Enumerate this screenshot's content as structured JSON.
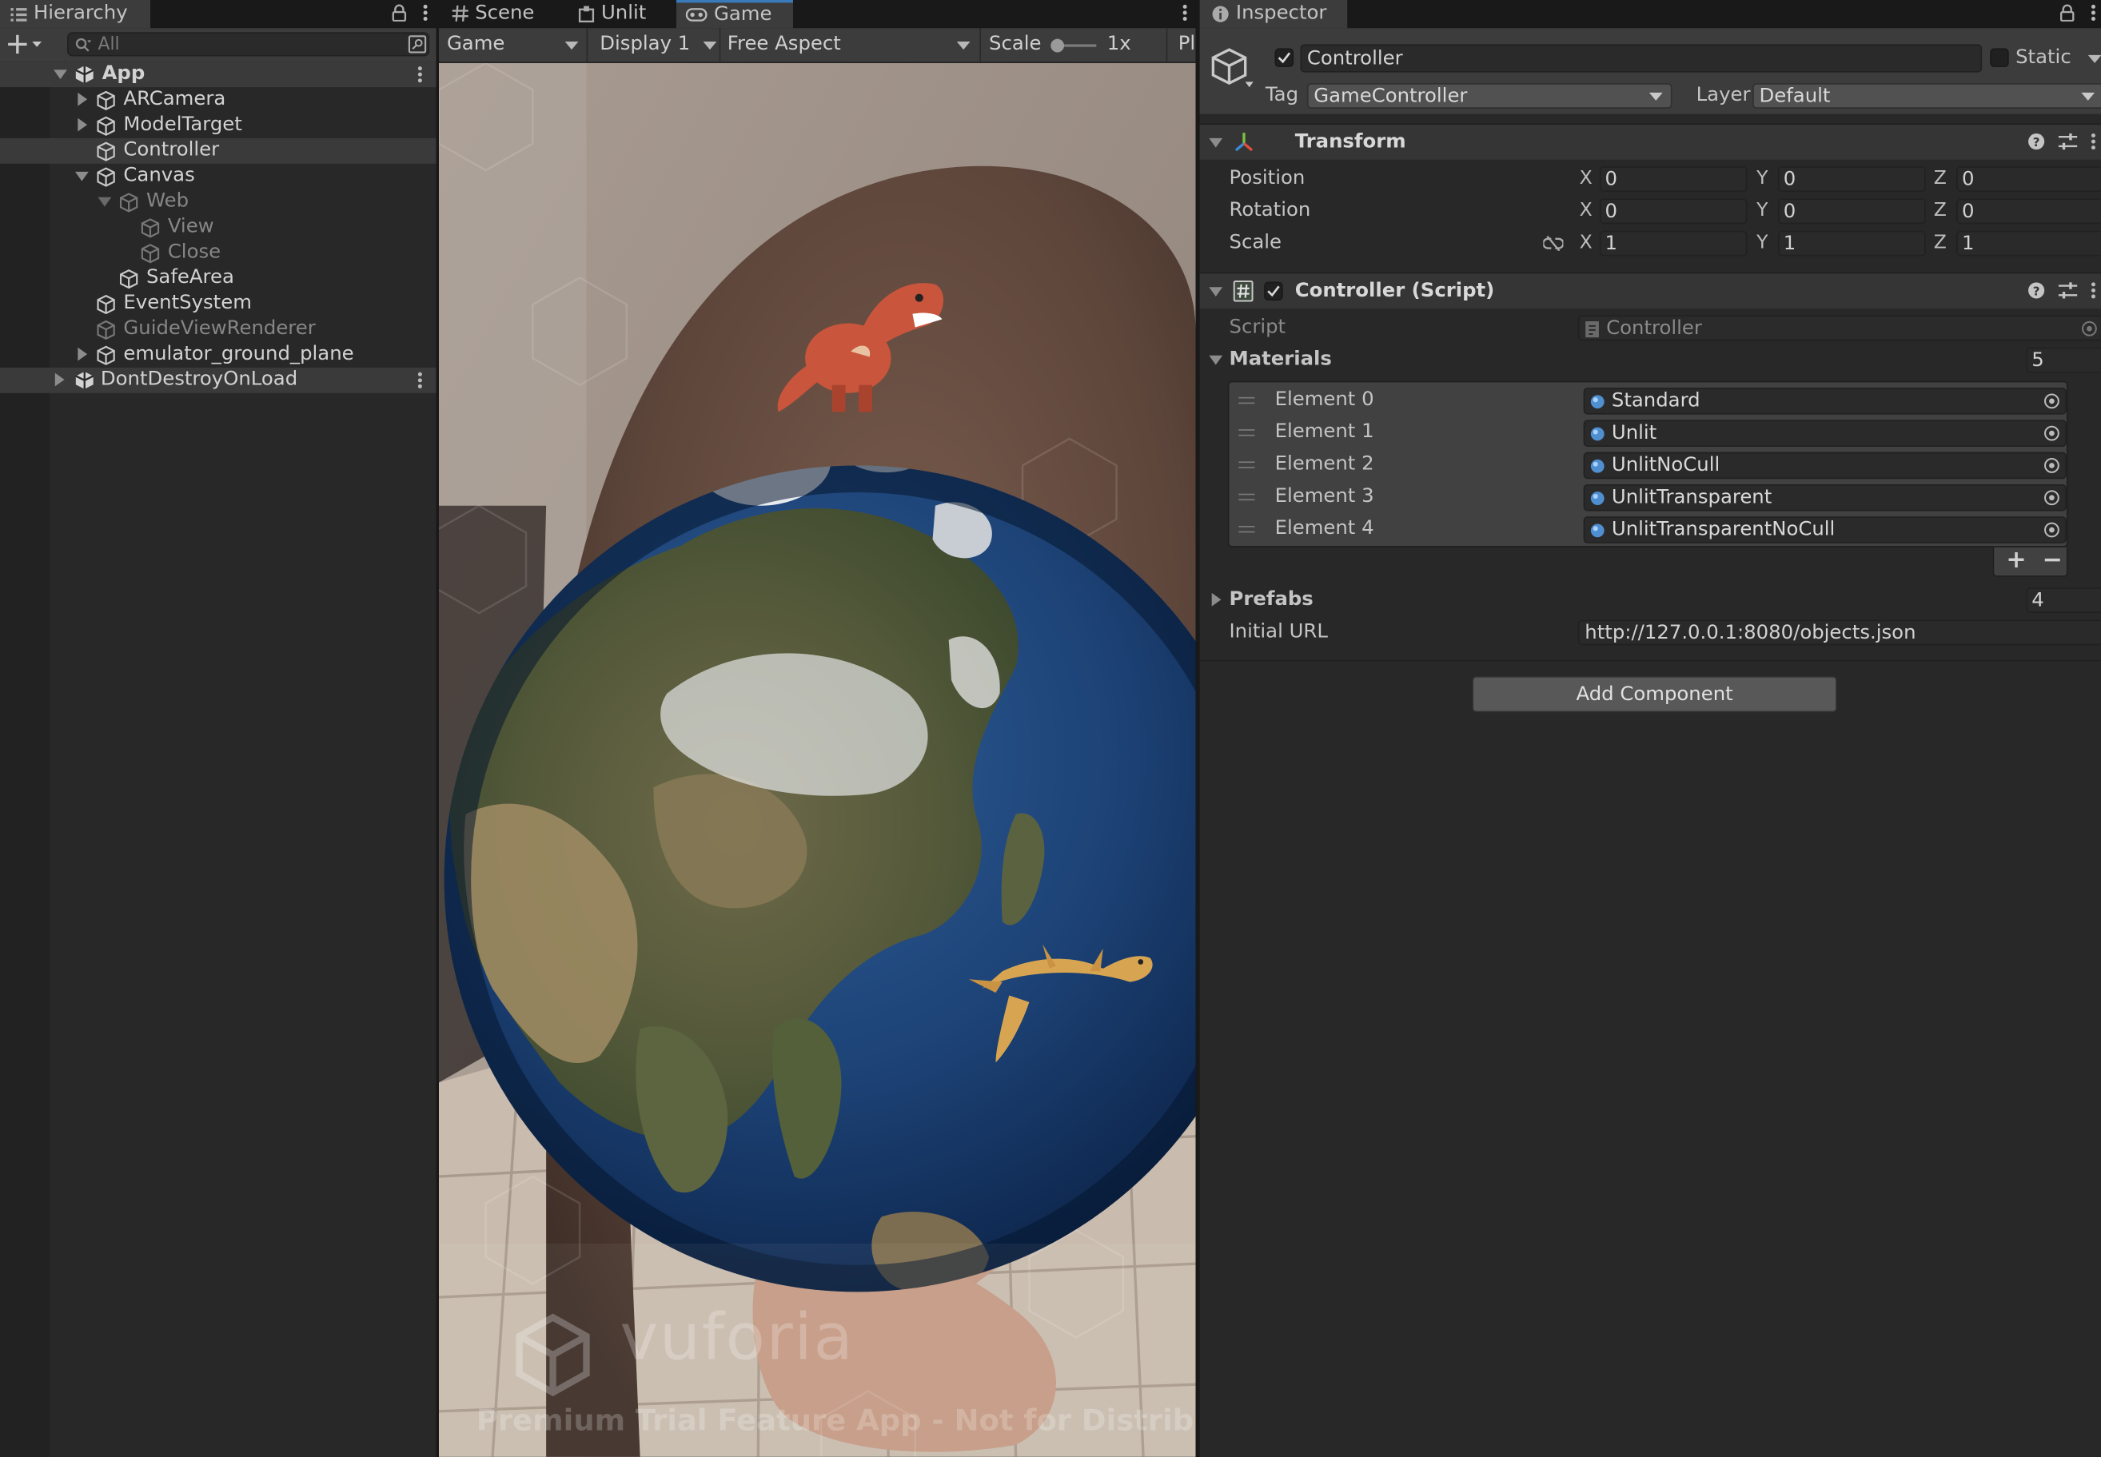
{
  "hierarchy": {
    "tab_label": "Hierarchy",
    "search_placeholder": "All",
    "items": [
      {
        "label": "App"
      },
      {
        "label": "ARCamera"
      },
      {
        "label": "ModelTarget"
      },
      {
        "label": "Controller"
      },
      {
        "label": "Canvas"
      },
      {
        "label": "Web"
      },
      {
        "label": "View"
      },
      {
        "label": "Close"
      },
      {
        "label": "SafeArea"
      },
      {
        "label": "EventSystem"
      },
      {
        "label": "GuideViewRenderer"
      },
      {
        "label": "emulator_ground_plane"
      },
      {
        "label": "DontDestroyOnLoad"
      }
    ]
  },
  "game": {
    "tabs": [
      {
        "label": "Scene"
      },
      {
        "label": "Unlit"
      },
      {
        "label": "Game"
      }
    ],
    "toolbar": {
      "mode": "Game",
      "display": "Display 1",
      "aspect": "Free Aspect",
      "scale_label": "Scale",
      "scale_value": "1x",
      "play_cut": "Pl"
    },
    "watermark": {
      "brand": "vuforia",
      "trial_text": "Premium Trial Feature App - Not for Distributio"
    }
  },
  "inspector": {
    "tab_label": "Inspector",
    "object_name": "Controller",
    "static_label": "Static",
    "tag_label": "Tag",
    "tag_value": "GameController",
    "layer_label": "Layer",
    "layer_value": "Default",
    "transform": {
      "title": "Transform",
      "rows": [
        {
          "label": "Position",
          "x": "0",
          "y": "0",
          "z": "0"
        },
        {
          "label": "Rotation",
          "x": "0",
          "y": "0",
          "z": "0"
        },
        {
          "label": "Scale",
          "x": "1",
          "y": "1",
          "z": "1"
        }
      ],
      "axis_x": "X",
      "axis_y": "Y",
      "axis_z": "Z"
    },
    "script_component": {
      "title": "Controller (Script)",
      "script_label": "Script",
      "script_value": "Controller",
      "materials_label": "Materials",
      "materials_count": "5",
      "materials": [
        {
          "label": "Element 0",
          "value": "Standard"
        },
        {
          "label": "Element 1",
          "value": "Unlit"
        },
        {
          "label": "Element 2",
          "value": "UnlitNoCull"
        },
        {
          "label": "Element 3",
          "value": "UnlitTransparent"
        },
        {
          "label": "Element 4",
          "value": "UnlitTransparentNoCull"
        }
      ],
      "add_symbol": "+",
      "remove_symbol": "−",
      "prefabs_label": "Prefabs",
      "prefabs_count": "4",
      "initial_url_label": "Initial URL",
      "initial_url_value": "http://127.0.0.1:8080/objects.json"
    },
    "add_component_label": "Add Component"
  },
  "colors": {
    "panel_bg": "#282828",
    "toolbar_bg": "#3c3c3c",
    "selected_row": "#3a3a3a",
    "text": "#d2d2d2",
    "dim_text": "#868686"
  }
}
